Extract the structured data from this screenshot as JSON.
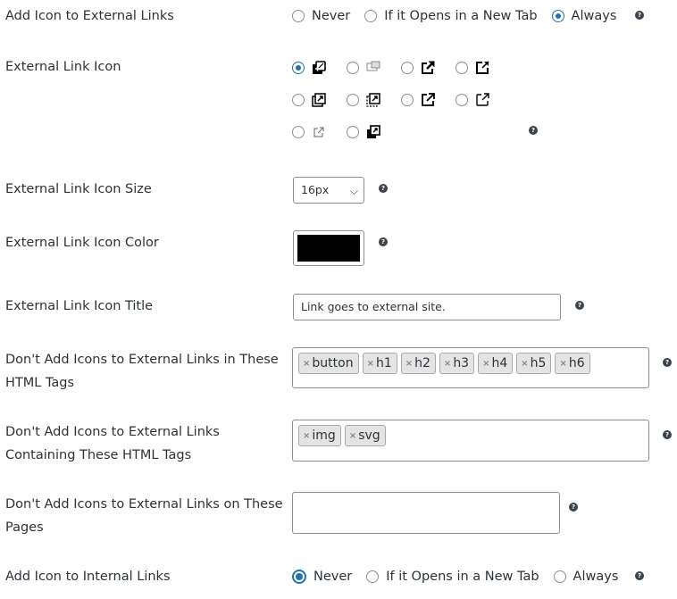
{
  "add_icon_external": {
    "label": "Add Icon to External Links",
    "options": [
      "Never",
      "If it Opens in a New Tab",
      "Always"
    ],
    "selected": "Always"
  },
  "external_link_icon": {
    "label": "External Link Icon",
    "icons": [
      "external-icon-1",
      "external-icon-2",
      "external-icon-3",
      "external-icon-4",
      "external-icon-5",
      "external-icon-6",
      "external-icon-7",
      "external-icon-8",
      "external-icon-9",
      "external-icon-10"
    ],
    "selected": "external-icon-1"
  },
  "icon_size": {
    "label": "External Link Icon Size",
    "value": "16px"
  },
  "icon_color": {
    "label": "External Link Icon Color",
    "value": "#000000"
  },
  "icon_title": {
    "label": "External Link Icon Title",
    "value": "Link goes to external site."
  },
  "exclude_tags": {
    "label_line1": "Don't Add Icons to External Links in These",
    "label_line2": "HTML Tags",
    "tags": [
      "button",
      "h1",
      "h2",
      "h3",
      "h4",
      "h5",
      "h6"
    ]
  },
  "exclude_containing": {
    "label_line1": "Don't Add Icons to External Links",
    "label_line2": "Containing These HTML Tags",
    "tags": [
      "img",
      "svg"
    ]
  },
  "exclude_pages": {
    "label_line1": "Don't Add Icons to External Links on These",
    "label_line2": "Pages",
    "value": ""
  },
  "add_icon_internal": {
    "label": "Add Icon to Internal Links",
    "options": [
      "Never",
      "If it Opens in a New Tab",
      "Always"
    ],
    "selected": "Never"
  },
  "help_glyph": "?",
  "tag_remove_glyph": "×",
  "select_chevron": "⌵"
}
